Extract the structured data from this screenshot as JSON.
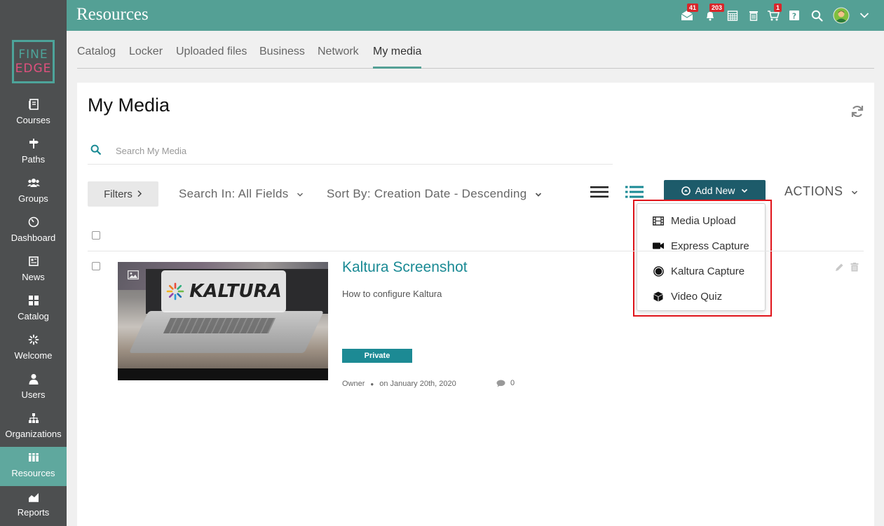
{
  "app": {
    "title": "Resources"
  },
  "logo": {
    "line1": "FINE",
    "line2": "EDGE"
  },
  "sidebar": {
    "items": [
      {
        "label": "Courses",
        "icon": "courses-icon"
      },
      {
        "label": "Paths",
        "icon": "paths-icon"
      },
      {
        "label": "Groups",
        "icon": "groups-icon"
      },
      {
        "label": "Dashboard",
        "icon": "dashboard-icon"
      },
      {
        "label": "News",
        "icon": "news-icon"
      },
      {
        "label": "Catalog",
        "icon": "catalog-icon"
      },
      {
        "label": "Welcome",
        "icon": "welcome-icon"
      },
      {
        "label": "Users",
        "icon": "users-icon"
      },
      {
        "label": "Organizations",
        "icon": "organizations-icon"
      },
      {
        "label": "Resources",
        "icon": "resources-icon",
        "active": true
      },
      {
        "label": "Reports",
        "icon": "reports-icon"
      }
    ]
  },
  "topbar": {
    "messages_badge": "41",
    "notifications_badge": "203",
    "cart_badge": "1"
  },
  "tabs": [
    {
      "label": "Catalog"
    },
    {
      "label": "Locker"
    },
    {
      "label": "Uploaded files"
    },
    {
      "label": "Business"
    },
    {
      "label": "Network"
    },
    {
      "label": "My media",
      "active": true
    }
  ],
  "page": {
    "title": "My Media",
    "search_placeholder": "Search My Media",
    "filters_label": "Filters",
    "search_in": "Search In: All Fields",
    "sort_by": "Sort By: Creation Date - Descending",
    "add_new_label": "Add New",
    "actions_label": "ACTIONS"
  },
  "add_new_menu": {
    "items": [
      {
        "label": "Media Upload",
        "icon": "film-icon"
      },
      {
        "label": "Express Capture",
        "icon": "video-camera-icon"
      },
      {
        "label": "Kaltura Capture",
        "icon": "record-icon"
      },
      {
        "label": "Video Quiz",
        "icon": "cube-icon"
      }
    ]
  },
  "entry": {
    "title": "Kaltura Screenshot",
    "description": "How to configure Kaltura",
    "thumbnail_logo_text": "KALTURA",
    "badge": "Private",
    "owner": "Owner",
    "date": "on January 20th, 2020",
    "comments": "0"
  },
  "colors": {
    "accent": "#54a095",
    "sidebar_bg": "#4d4f50",
    "add_new_bg": "#1d5b6a",
    "link": "#1a8a94",
    "highlight_border": "#e0141b",
    "badge_red": "#d9262a"
  }
}
